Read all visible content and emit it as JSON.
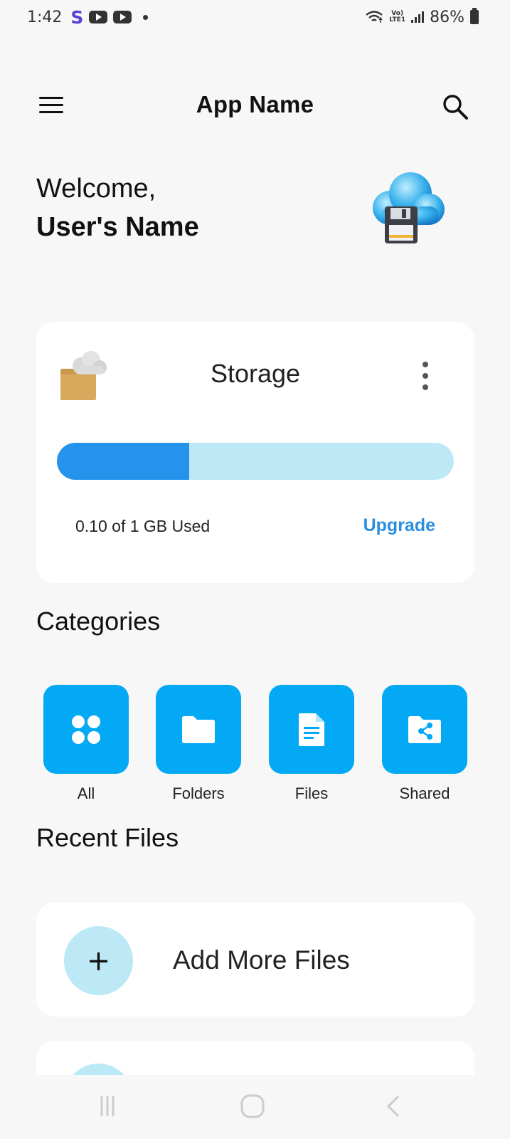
{
  "status_bar": {
    "time": "1:42",
    "app_letter": "S",
    "lte_line1": "Vo)",
    "lte_line2": "LTE1",
    "battery": "86%"
  },
  "app_bar": {
    "title": "App Name",
    "menu_icon": "hamburger-menu-icon",
    "search_icon": "search-icon"
  },
  "welcome": {
    "greeting": "Welcome,",
    "user_name": "User's Name",
    "illustration": "cloud-floppy-icon"
  },
  "storage": {
    "title": "Storage",
    "used_fraction": 0.334,
    "usage_text": "0.10 of 1 GB Used",
    "upgrade_label": "Upgrade",
    "fill_color": "#2593ec",
    "track_color": "#bde9f7"
  },
  "categories": {
    "title": "Categories",
    "items": [
      {
        "label": "All",
        "icon": "grid-icon"
      },
      {
        "label": "Folders",
        "icon": "folder-icon"
      },
      {
        "label": "Files",
        "icon": "document-icon"
      },
      {
        "label": "Shared",
        "icon": "shared-folder-icon"
      }
    ],
    "tile_color": "#03a9f4"
  },
  "recent_files": {
    "title": "Recent Files",
    "add_symbol": "+",
    "add_label": "Add More Files"
  }
}
